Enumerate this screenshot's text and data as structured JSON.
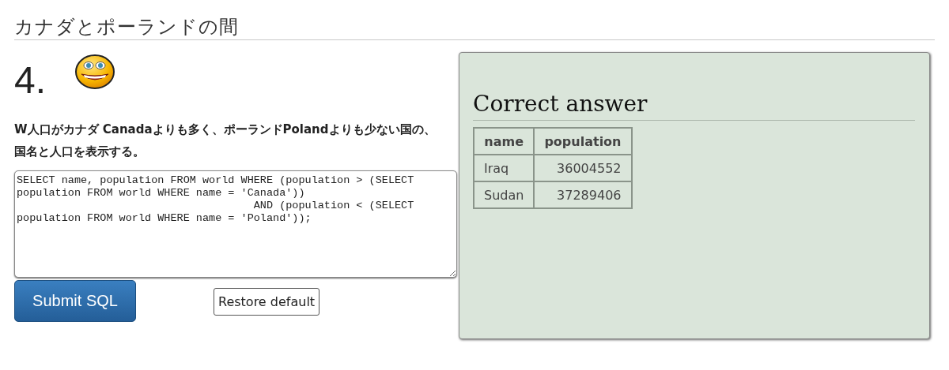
{
  "page_title": "カナダとポーランドの間",
  "question": {
    "number": "4.",
    "text": "W人口がカナダ Canadaよりも多く、ポーランドPolandよりも少ない国の、国名と人口を表示する。"
  },
  "sql_editor": {
    "value": "SELECT name, population FROM world WHERE (population > (SELECT population FROM world WHERE name = 'Canada'))\n                                     AND (population < (SELECT population FROM world WHERE name = 'Poland'));"
  },
  "buttons": {
    "submit": "Submit SQL",
    "restore": "Restore default"
  },
  "answer_panel": {
    "title": "Correct answer",
    "table": {
      "columns": [
        "name",
        "population"
      ],
      "rows": [
        [
          "Iraq",
          "36004552"
        ],
        [
          "Sudan",
          "37289406"
        ]
      ]
    }
  }
}
